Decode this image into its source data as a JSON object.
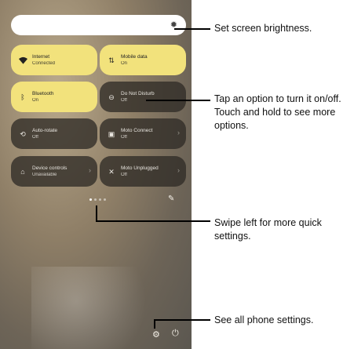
{
  "brightness": {
    "icon": "sun-icon"
  },
  "tiles": [
    {
      "label": "Internet",
      "status": "Connected",
      "icon": "wifi-icon"
    },
    {
      "label": "Mobile data",
      "status": "On",
      "icon": "mobile-data-icon"
    },
    {
      "label": "Bluetooth",
      "status": "On",
      "icon": "bluetooth-icon"
    },
    {
      "label": "Do Not Disturb",
      "status": "Off",
      "icon": "do-not-disturb-icon"
    },
    {
      "label": "Auto-rotate",
      "status": "Off",
      "icon": "auto-rotate-icon"
    },
    {
      "label": "Moto Connect",
      "status": "Off",
      "icon": "moto-connect-icon"
    },
    {
      "label": "Device controls",
      "status": "Unavailable",
      "icon": "home-icon"
    },
    {
      "label": "Moto Unplugged",
      "status": "Off",
      "icon": "moto-unplugged-icon"
    }
  ],
  "callouts": {
    "brightness": "Set screen brightness.",
    "tap_option": "Tap an option to turn it on/off. Touch and hold to see more options.",
    "swipe": "Swipe left for more quick settings.",
    "settings": "See all phone settings."
  },
  "colors": {
    "tile_on": "#f2e27c",
    "tile_off": "#302c26"
  }
}
